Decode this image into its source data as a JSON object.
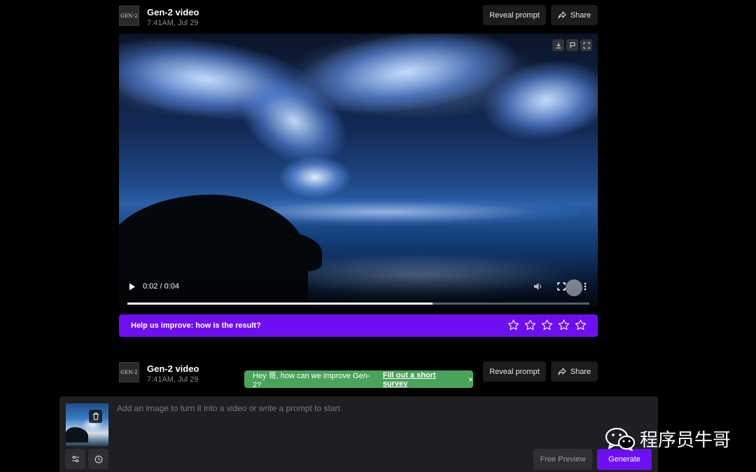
{
  "cards": [
    {
      "logo_text": "GEN-2",
      "title": "Gen-2 video",
      "time": "7:41AM, Jul 29",
      "reveal_label": "Reveal prompt",
      "share_label": "Share"
    },
    {
      "logo_text": "GEN-2",
      "title": "Gen-2 video",
      "time": "7:41AM, Jul 29",
      "reveal_label": "Reveal prompt",
      "share_label": "Share"
    }
  ],
  "video": {
    "time_display": "0:02 / 0:04",
    "progress_fraction": 0.66,
    "top_icons": [
      "download-icon",
      "flag-icon",
      "expand-icon"
    ]
  },
  "feedback": {
    "text": "Help us improve: how is the result?",
    "star_count": 5
  },
  "toast": {
    "text": "Hey 哥, how can we improve Gen-2?",
    "link": "Fill out a short survey",
    "close": "×"
  },
  "composer": {
    "placeholder": "Add an image to turn it into a video or write a prompt to start",
    "free_preview_label": "Free Preview",
    "generate_label": "Generate"
  },
  "watermark": {
    "text": "程序员牛哥"
  },
  "colors": {
    "accent": "#6d0ff2",
    "toast": "#4aa35a",
    "background": "#000000",
    "panel": "#1e1f23"
  }
}
